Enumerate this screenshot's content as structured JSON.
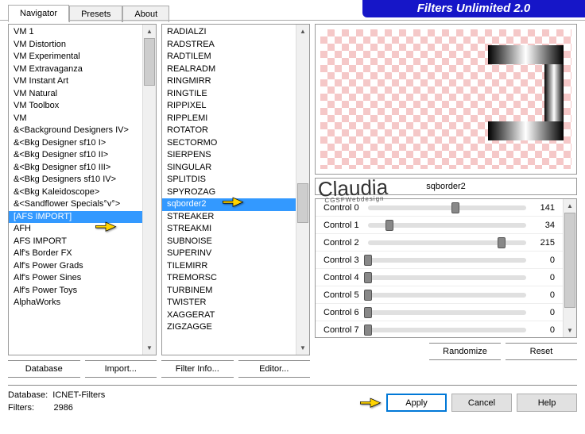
{
  "header": {
    "title": "Filters Unlimited 2.0"
  },
  "tabs": [
    "Navigator",
    "Presets",
    "About"
  ],
  "activeTab": 0,
  "categories": [
    "VM 1",
    "VM Distortion",
    "VM Experimental",
    "VM Extravaganza",
    "VM Instant Art",
    "VM Natural",
    "VM Toolbox",
    "VM",
    "&<Background Designers IV>",
    "&<Bkg Designer sf10 I>",
    "&<Bkg Designer sf10 II>",
    "&<Bkg Designer sf10 III>",
    "&<Bkg Designers sf10 IV>",
    "&<Bkg Kaleidoscope>",
    "&<Sandflower Specials°v°>",
    "[AFS IMPORT]",
    "AFH",
    "AFS IMPORT",
    "Alf's Border FX",
    "Alf's Power Grads",
    "Alf's Power Sines",
    "Alf's Power Toys",
    "AlphaWorks"
  ],
  "categorySelectedIndex": 15,
  "filters": [
    "RADIALZI",
    "RADSTREA",
    "RADTILEM",
    "REALRADM",
    "RINGMIRR",
    "RINGTILE",
    "RIPPIXEL",
    "RIPPLEMI",
    "ROTATOR",
    "SECTORMO",
    "SIERPENS",
    "SINGULAR",
    "SPLITDIS",
    "SPYROZAG",
    "sqborder2",
    "STREAKER",
    "STREAKMI",
    "SUBNOISE",
    "SUPERINV",
    "TILEMIRR",
    "TREMORSC",
    "TURBINEM",
    "TWISTER",
    "XAGGERAT",
    "ZIGZAGGE"
  ],
  "filterSelectedIndex": 14,
  "catButtons": {
    "database": "Database",
    "import": "Import..."
  },
  "filterButtons": {
    "info": "Filter Info...",
    "editor": "Editor..."
  },
  "previewButtons": {
    "randomize": "Randomize",
    "reset": "Reset"
  },
  "selectedFilterName": "sqborder2",
  "controls": [
    {
      "label": "Control 0",
      "value": 141
    },
    {
      "label": "Control 1",
      "value": 34
    },
    {
      "label": "Control 2",
      "value": 215
    },
    {
      "label": "Control 3",
      "value": 0
    },
    {
      "label": "Control 4",
      "value": 0
    },
    {
      "label": "Control 5",
      "value": 0
    },
    {
      "label": "Control 6",
      "value": 0
    },
    {
      "label": "Control 7",
      "value": 0
    }
  ],
  "footer": {
    "dbLabel": "Database:",
    "dbValue": "ICNET-Filters",
    "filtersLabel": "Filters:",
    "filtersValue": "2986"
  },
  "dlgButtons": {
    "apply": "Apply",
    "cancel": "Cancel",
    "help": "Help"
  },
  "watermark": {
    "name": "Claudia",
    "sub": "CGSFWebdesign"
  }
}
